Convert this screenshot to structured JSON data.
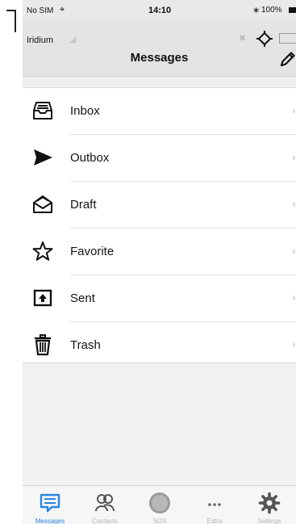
{
  "status_bar": {
    "carrier": "No SIM",
    "time": "14:10",
    "battery": "100%"
  },
  "header": {
    "device_name": "Iridium",
    "title": "Messages"
  },
  "folders": [
    {
      "label": "Inbox",
      "icon": "inbox-tray-icon"
    },
    {
      "label": "Outbox",
      "icon": "send-arrow-icon"
    },
    {
      "label": "Draft",
      "icon": "open-envelope-icon"
    },
    {
      "label": "Favorite",
      "icon": "star-icon"
    },
    {
      "label": "Sent",
      "icon": "upload-box-icon"
    },
    {
      "label": "Trash",
      "icon": "trash-can-icon"
    }
  ],
  "tabs": [
    {
      "label": "Messages",
      "icon": "message-bubble-icon",
      "active": true
    },
    {
      "label": "Contacts",
      "icon": "contacts-icon",
      "active": false
    },
    {
      "label": "SOS",
      "icon": "sos-circle-icon",
      "active": false
    },
    {
      "label": "Extra",
      "icon": "more-dots-icon",
      "active": false
    },
    {
      "label": "Settings",
      "icon": "settings-gear-icon",
      "active": false
    }
  ],
  "colors": {
    "accent": "#2a86e0",
    "inactive": "#b5b5b5"
  }
}
